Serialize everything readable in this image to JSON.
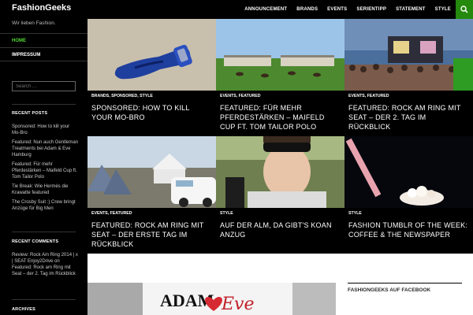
{
  "site": {
    "title": "FashionGeeks",
    "tagline": "Wir lieben Fashion."
  },
  "colors": {
    "accent": "#24890d",
    "accent_text": "#55d737",
    "background": "#000000",
    "content": "#ffffff"
  },
  "nav": {
    "items": [
      "ANNOUNCEMENT",
      "BRANDS",
      "EVENTS",
      "SERIENTIPP",
      "STATEMENT",
      "STYLE"
    ],
    "search_icon": "search-icon"
  },
  "menu": {
    "items": [
      {
        "label": "HOME"
      },
      {
        "label": "IMPRESSUM"
      }
    ]
  },
  "search": {
    "placeholder": "Search …"
  },
  "recent_posts": {
    "title": "RECENT POSTS",
    "items": [
      "Sponsored: How to kill your Mo-Bro",
      "Featured: Nun auch Gentleman Treatments bei Adam & Eve Hamburg",
      "Featured: Für mehr Pferdestärken – Maifeld Cup ft. Tom Tailor Polo",
      "Tie Break: Wie Hermès die Krawatte featured",
      "The Crosby Suit :) Crew bringt Anzüge für Big Men"
    ]
  },
  "recent_comments": {
    "title": "RECENT COMMENTS",
    "items": [
      {
        "author": "Review: Rock Am Ring 2014 | x | SEAT Enjoy2Drive",
        "on": "on",
        "post": "Featured: Rock am Ring mit Seat – der 2. Tag im Rückblick"
      }
    ]
  },
  "archives": {
    "title": "ARCHIVES"
  },
  "tiles": [
    {
      "meta": "BRANDS, SPONSORED, STYLE",
      "title": "SPONSORED: HOW TO KILL YOUR MO-BRO"
    },
    {
      "meta": "EVENTS, FEATURED",
      "title": "FEATURED: FÜR MEHR PFERDESTÄRKEN – MAIFELD CUP FT. TOM TAILOR POLO"
    },
    {
      "meta": "EVENTS, FEATURED",
      "title": "FEATURED: ROCK AM RING MIT SEAT – DER 2. TAG IM RÜCKBLICK"
    },
    {
      "meta": "EVENTS, FEATURED",
      "title": "FEATURED: ROCK AM RING MIT SEAT – DER ERSTE TAG IM RÜCKBLICK"
    },
    {
      "meta": "STYLE",
      "title": "AUF DER ALM, DA GIBT'S KOAN ANZUG"
    },
    {
      "meta": "STYLE",
      "title": "FASHION TUMBLR OF THE WEEK: COFFEE & THE NEWSPAPER"
    }
  ],
  "featured_image": {
    "sign_text": "ADAM",
    "script_text": "Eve"
  },
  "facebook_widget": {
    "title": "FASHIONGEEKS AUF FACEBOOK"
  }
}
